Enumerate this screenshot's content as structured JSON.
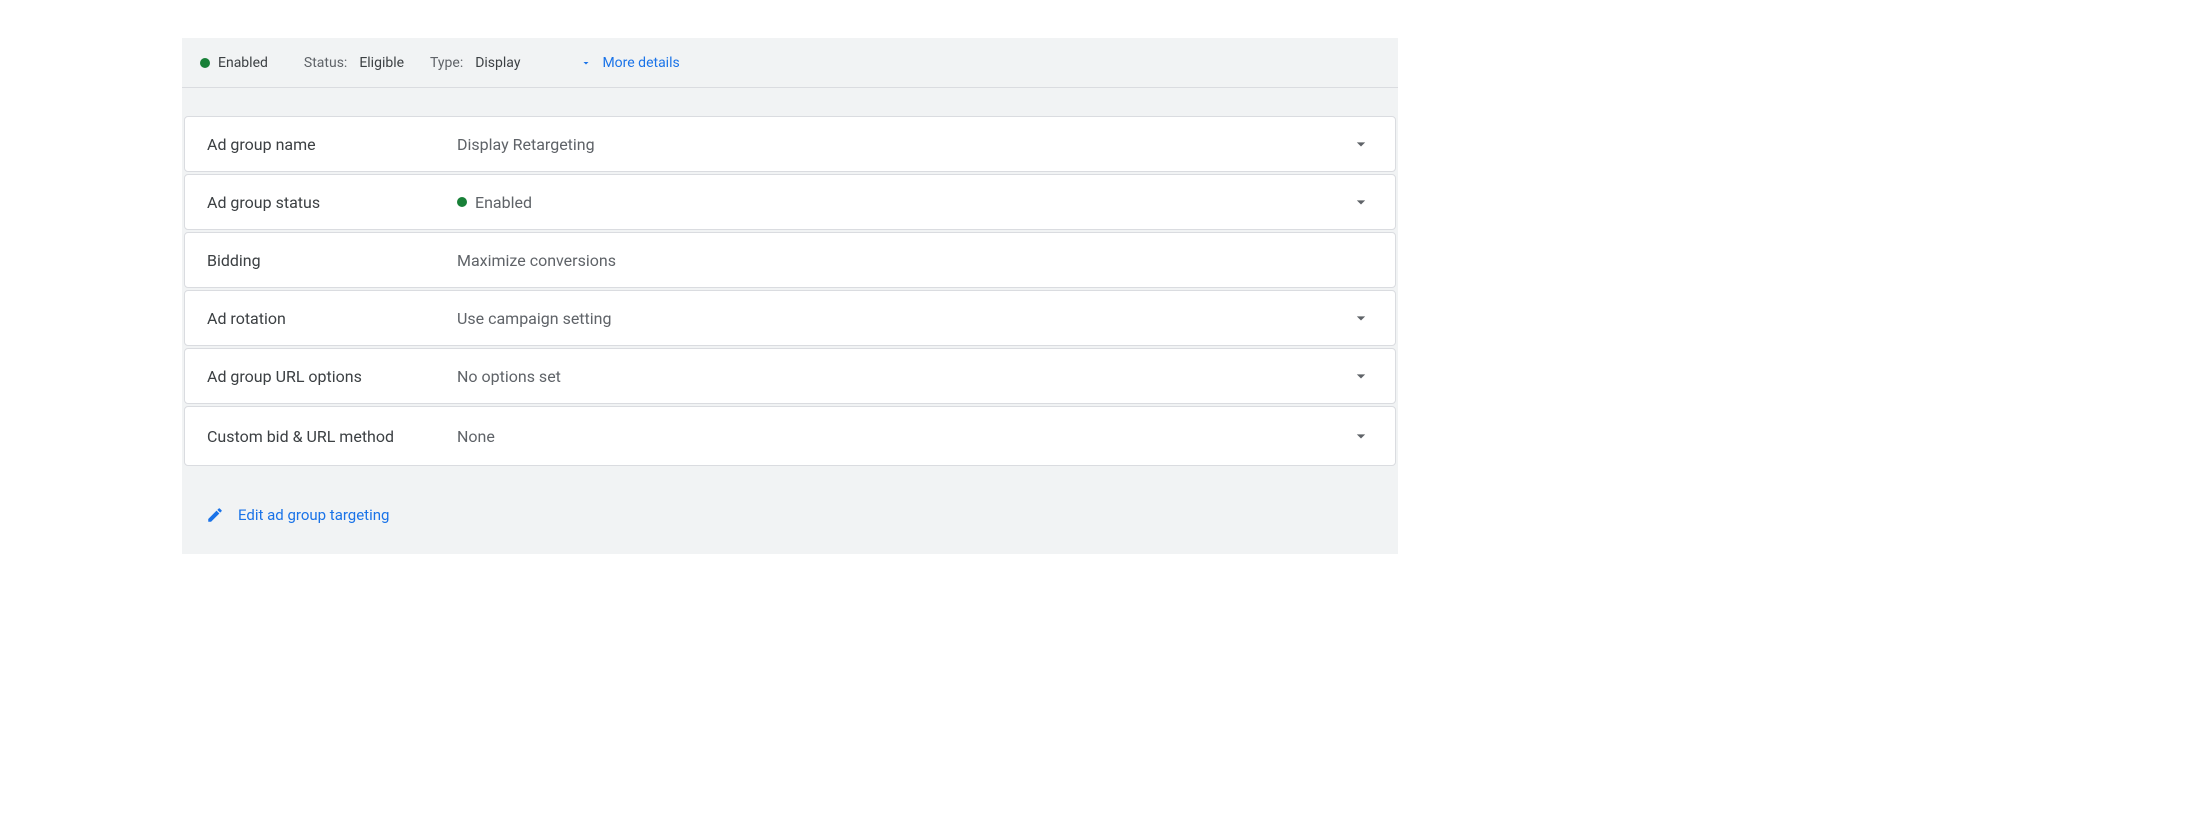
{
  "status": {
    "enabled_label": "Enabled",
    "status_key": "Status:",
    "status_value": "Eligible",
    "type_key": "Type:",
    "type_value": "Display",
    "more_details": "More details"
  },
  "cards": {
    "ad_group_name": {
      "label": "Ad group name",
      "value": "Display Retargeting"
    },
    "ad_group_status": {
      "label": "Ad group status",
      "value": "Enabled"
    },
    "bidding": {
      "label": "Bidding",
      "value": "Maximize conversions"
    },
    "ad_rotation": {
      "label": "Ad rotation",
      "value": "Use campaign setting"
    },
    "url_options": {
      "label": "Ad group URL options",
      "value": "No options set"
    },
    "custom_bid": {
      "label": "Custom bid & URL method",
      "value": "None"
    }
  },
  "edit_link": "Edit ad group targeting"
}
